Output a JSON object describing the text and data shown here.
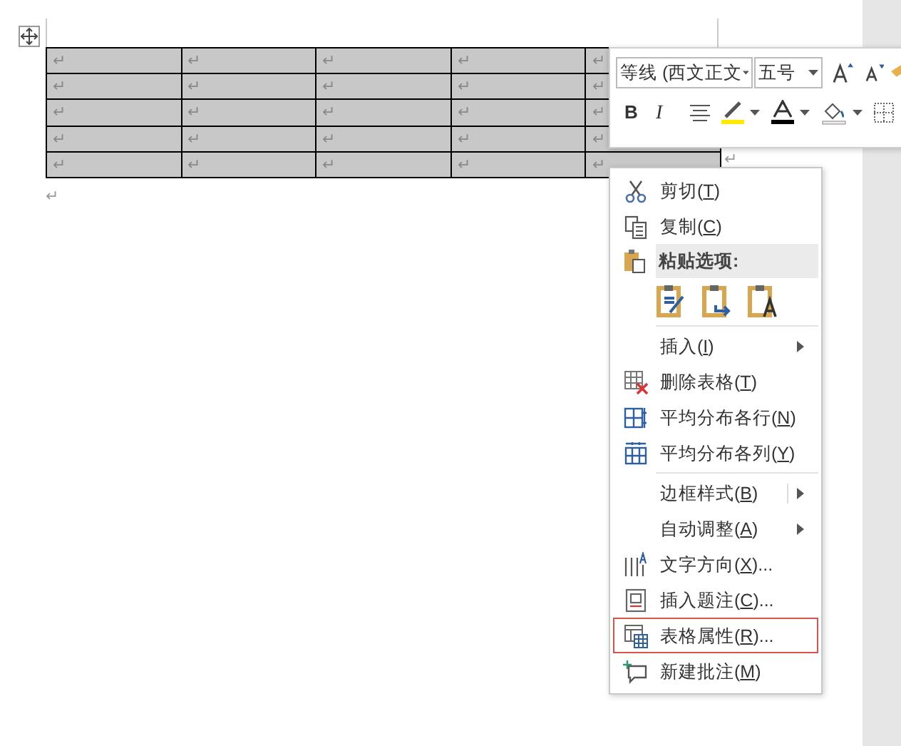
{
  "table": {
    "selected": true,
    "rows": [
      [
        "↵",
        "↵",
        "↵",
        "↵",
        "↵"
      ],
      [
        "↵",
        "↵",
        "↵",
        "↵",
        "↵"
      ],
      [
        "↵",
        "↵",
        "↵",
        "↵",
        "↵"
      ],
      [
        "↵",
        "↵",
        "↵",
        "↵",
        "↵"
      ],
      [
        "↵",
        "↵",
        "↵",
        "↵",
        "↵"
      ]
    ],
    "row_end_mark": "↵",
    "paragraph_mark": "↵"
  },
  "mini_toolbar": {
    "font": "等线 (西文正文",
    "size": "五号",
    "bold": "B",
    "italic": "I"
  },
  "context_menu": [
    {
      "kind": "command",
      "pre": "剪切(",
      "key": "T",
      "post": ")",
      "highlighted": false
    },
    {
      "kind": "command",
      "pre": "复制(",
      "key": "C",
      "post": ")",
      "highlighted": false
    },
    {
      "kind": "header",
      "pre": "粘贴选项:"
    },
    {
      "kind": "paste_options"
    },
    {
      "kind": "separator"
    },
    {
      "kind": "submenu",
      "pre": "插入(",
      "key": "I",
      "post": ")",
      "split": false
    },
    {
      "kind": "command",
      "pre": "删除表格(",
      "key": "T",
      "post": ")",
      "highlighted": false
    },
    {
      "kind": "command",
      "pre": "平均分布各行(",
      "key": "N",
      "post": ")",
      "highlighted": false
    },
    {
      "kind": "command",
      "pre": "平均分布各列(",
      "key": "Y",
      "post": ")",
      "highlighted": false
    },
    {
      "kind": "separator"
    },
    {
      "kind": "submenu",
      "pre": "边框样式(",
      "key": "B",
      "post": ")",
      "split": true
    },
    {
      "kind": "submenu",
      "pre": "自动调整(",
      "key": "A",
      "post": ")",
      "split": false
    },
    {
      "kind": "command",
      "pre": "文字方向(",
      "key": "X",
      "post": ")...",
      "highlighted": false
    },
    {
      "kind": "command",
      "pre": "插入题注(",
      "key": "C",
      "post": ")...",
      "highlighted": false
    },
    {
      "kind": "command",
      "pre": "表格属性(",
      "key": "R",
      "post": ")...",
      "highlighted": true
    },
    {
      "kind": "command",
      "pre": "新建批注(",
      "key": "M",
      "post": ")",
      "highlighted": false
    }
  ]
}
